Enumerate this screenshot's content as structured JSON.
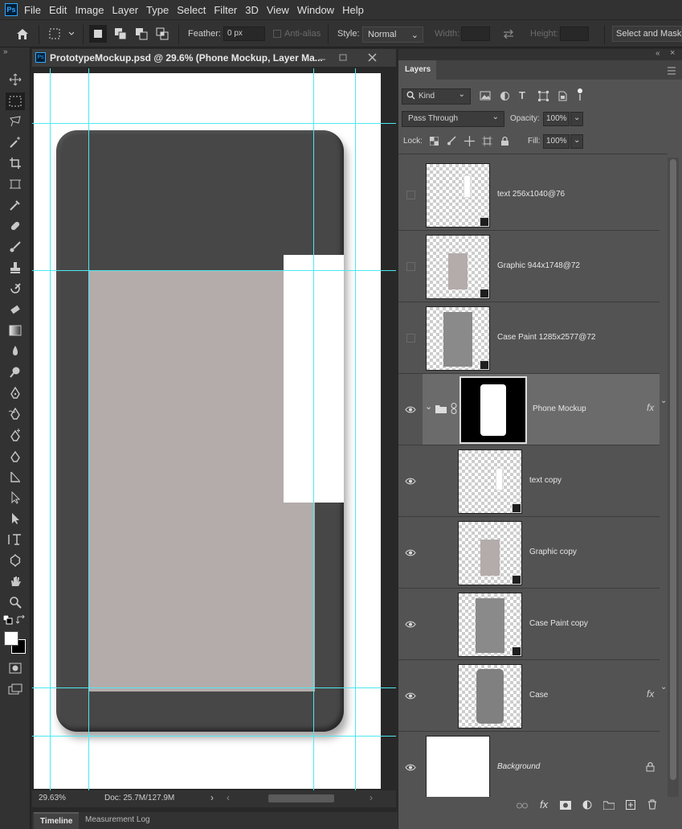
{
  "app": {
    "logo_text": "Ps",
    "accent": "#31a8ff"
  },
  "menu": [
    "File",
    "Edit",
    "Image",
    "Layer",
    "Type",
    "Select",
    "Filter",
    "3D",
    "View",
    "Window",
    "Help"
  ],
  "options": {
    "feather_label": "Feather:",
    "feather_value": "0 px",
    "antialias_label": "Anti-alias",
    "style_label": "Style:",
    "style_value": "Normal",
    "width_label": "Width:",
    "height_label": "Height:",
    "select_mask_label": "Select and Mask..."
  },
  "document": {
    "title": "PrototypeMockup.psd @ 29.6% (Phone Mockup, Layer Ma...",
    "zoom": "29.63%",
    "doc_size": "Doc: 25.7M/127.9M"
  },
  "bottom_tabs": [
    "Timeline",
    "Measurement Log"
  ],
  "layers_panel": {
    "tab": "Layers",
    "filter_kind": "Kind",
    "blend_mode": "Pass Through",
    "opacity_label": "Opacity:",
    "opacity_value": "100%",
    "lock_label": "Lock:",
    "fill_label": "Fill:",
    "fill_value": "100%",
    "layers": [
      {
        "name": "text 256x1040@76",
        "visible": false,
        "indent": 0,
        "thumb": "text",
        "smart": true
      },
      {
        "name": "Graphic 944x1748@72",
        "visible": false,
        "indent": 0,
        "thumb": "graphic",
        "smart": true
      },
      {
        "name": "Case Paint 1285x2577@72",
        "visible": false,
        "indent": 0,
        "thumb": "paint",
        "smart": true
      },
      {
        "name": "Phone Mockup",
        "visible": true,
        "indent": 0,
        "thumb": "mask",
        "group": true,
        "fx": true,
        "selected": true
      },
      {
        "name": "text copy",
        "visible": true,
        "indent": 1,
        "thumb": "text",
        "smart": true
      },
      {
        "name": "Graphic copy",
        "visible": true,
        "indent": 1,
        "thumb": "graphic",
        "smart": true
      },
      {
        "name": "Case Paint copy",
        "visible": true,
        "indent": 1,
        "thumb": "paint",
        "smart": true
      },
      {
        "name": "Case",
        "visible": true,
        "indent": 1,
        "thumb": "case",
        "fx": true
      },
      {
        "name": "Background",
        "visible": true,
        "indent": 0,
        "thumb": "white",
        "locked": true
      }
    ]
  }
}
